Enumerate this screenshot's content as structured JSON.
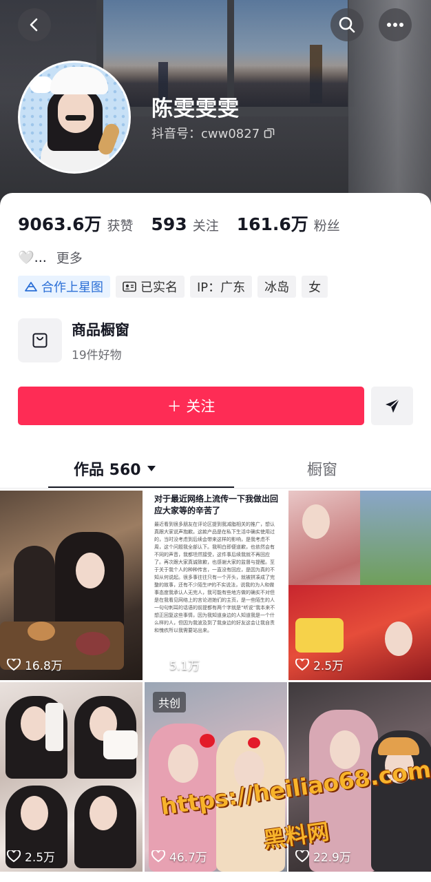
{
  "profile": {
    "name": "陈雯雯雯",
    "douyin_id": "抖音号：cww0827"
  },
  "stats": [
    {
      "num": "9063.6万",
      "label": "获赞"
    },
    {
      "num": "593",
      "label": "关注"
    },
    {
      "num": "161.6万",
      "label": "粉丝"
    }
  ],
  "bio": {
    "text": "🤍...",
    "more": "更多"
  },
  "tags": [
    "合作上星图",
    "已实名",
    "IP：广东",
    "冰岛",
    "女"
  ],
  "shop": {
    "title": "商品橱窗",
    "subtitle": "19件好物"
  },
  "actions": {
    "follow": "＋ 关注"
  },
  "tabs": {
    "works": "作品 560",
    "window": "橱窗"
  },
  "grid": [
    {
      "likes": "16.8万"
    },
    {
      "likes": "5.1万",
      "doc_title": "对于最近网络上流传一下我做出回应大家等的辛苦了",
      "doc_body": "最近看到很多朋友在评论区提到我减脂相关的推广，想认真跟大家说声抱歉。这款产品是在私下生活中确实使用过的，当时没考虑到后续会带来这样的影响，是我考虑不周，这个问题我全部认下。我明白即便道歉，也依然会有不同的声音，我都坦然接受，这件事后续我就不再回应了。再次跟大家真诚致歉，也感谢大家的监督与提醒。至于关于我个人的种种传言，一直没有回应，是因为真的不知从何说起。很多事往往只有一个开头，就被拼凑成了完整的故事，还有不少陌生IP的不实说法，说我的为人和做事态度我承认人无完人，我可能有些地方做的确实不对但是在我看见网络上的言论进她们的主页，是一些陌生的人一句句刺耳的话语的前提都有两个字就是“听说”我本来不想正回复这些事情，因为我知道身边的人知道我是一个什么样的人，但因为我波及到了我身边的好友这会让我自责和愧疚所以我需要站出来。"
    },
    {
      "likes": "2.5万"
    },
    {
      "likes": "2.5万"
    },
    {
      "likes": "46.7万",
      "badge": "共创"
    },
    {
      "likes": "22.9万"
    }
  ],
  "watermark": {
    "url": "https://heiliao68.com",
    "name": "黑料网"
  }
}
